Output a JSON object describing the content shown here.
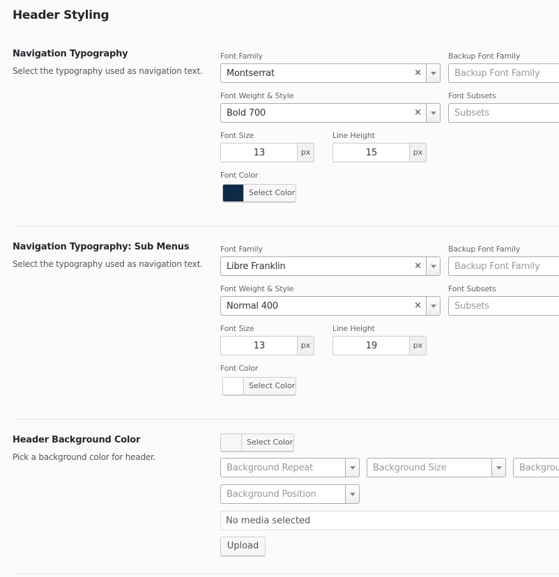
{
  "page": {
    "title": "Header Styling"
  },
  "sections": [
    {
      "title": "Navigation Typography",
      "description": "Select the typography used as navigation text.",
      "font_family_label": "Font Family",
      "font_family_value": "Montserrat",
      "backup_font_label": "Backup Font Family",
      "backup_font_placeholder": "Backup Font Family",
      "weight_label": "Font Weight & Style",
      "weight_value": "Bold 700",
      "subsets_label": "Font Subsets",
      "subsets_placeholder": "Subsets",
      "font_size_label": "Font Size",
      "font_size_value": "13",
      "font_size_unit": "px",
      "line_height_label": "Line Height",
      "line_height_value": "15",
      "line_height_unit": "px",
      "font_color_label": "Font Color",
      "font_color_swatch": "#0e2a47",
      "select_color_label": "Select Color"
    },
    {
      "title": "Navigation Typography: Sub Menus",
      "description": "Select the typography used as navigation text.",
      "font_family_label": "Font Family",
      "font_family_value": "Libre Franklin",
      "backup_font_label": "Backup Font Family",
      "backup_font_placeholder": "Backup Font Family",
      "weight_label": "Font Weight & Style",
      "weight_value": "Normal 400",
      "subsets_label": "Font Subsets",
      "subsets_placeholder": "Subsets",
      "font_size_label": "Font Size",
      "font_size_value": "13",
      "font_size_unit": "px",
      "line_height_label": "Line Height",
      "line_height_value": "19",
      "line_height_unit": "px",
      "font_color_label": "Font Color",
      "font_color_swatch": "#ffffff",
      "select_color_label": "Select Color"
    }
  ],
  "header_bg": {
    "title": "Header Background Color",
    "description": "Pick a background color for header.",
    "select_color_label": "Select Color",
    "swatch": "#f7f7f7",
    "repeat_placeholder": "Background Repeat",
    "size_placeholder": "Background Size",
    "third_placeholder": "Backgrou",
    "position_placeholder": "Background Position",
    "media_text": "No media selected",
    "upload_label": "Upload"
  },
  "icons": {
    "clear": "×",
    "dropdown": "chevron-down-icon"
  }
}
